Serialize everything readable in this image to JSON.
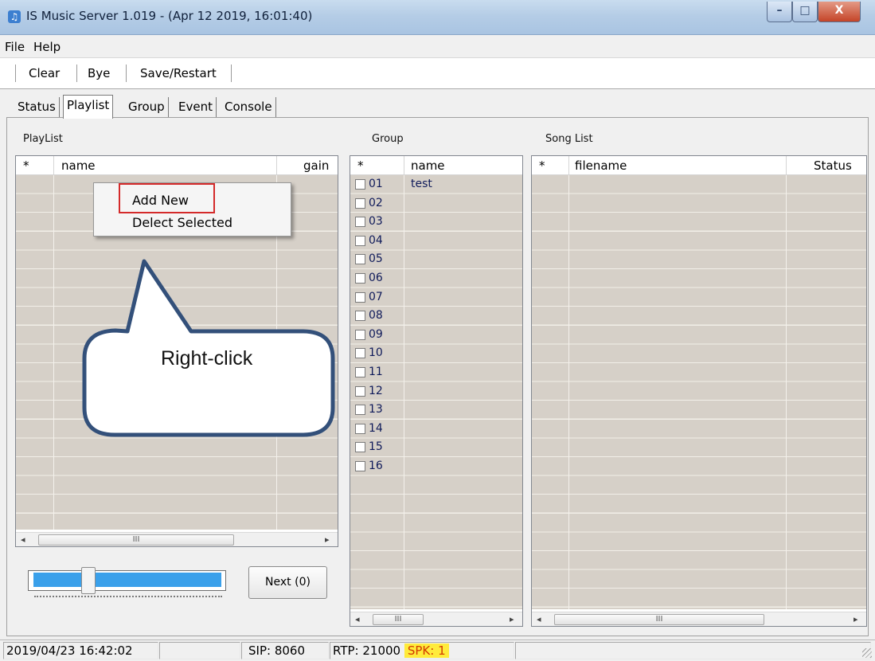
{
  "window": {
    "title": "IS Music Server 1.019 - (Apr 12 2019, 16:01:40)",
    "icon": "music-note-icon",
    "min_glyph": "–",
    "max_glyph": "□",
    "close_glyph": "X"
  },
  "menu": {
    "file": "File",
    "help": "Help"
  },
  "toolbar": {
    "clear": "Clear",
    "bye": "Bye",
    "save_restart": "Save/Restart"
  },
  "tabs": [
    "Status",
    "Playlist",
    "Group",
    "Event",
    "Console"
  ],
  "active_tab": "Playlist",
  "playlist": {
    "label": "PlayList",
    "columns": [
      "*",
      "name",
      "gain"
    ],
    "context_menu": [
      "Add New",
      "Delect Selected"
    ]
  },
  "group": {
    "label": "Group",
    "columns": [
      "*",
      "name"
    ],
    "rows": [
      {
        "num": "01",
        "name": "test"
      },
      {
        "num": "02",
        "name": ""
      },
      {
        "num": "03",
        "name": ""
      },
      {
        "num": "04",
        "name": ""
      },
      {
        "num": "05",
        "name": ""
      },
      {
        "num": "06",
        "name": ""
      },
      {
        "num": "07",
        "name": ""
      },
      {
        "num": "08",
        "name": ""
      },
      {
        "num": "09",
        "name": ""
      },
      {
        "num": "10",
        "name": ""
      },
      {
        "num": "11",
        "name": ""
      },
      {
        "num": "12",
        "name": ""
      },
      {
        "num": "13",
        "name": ""
      },
      {
        "num": "14",
        "name": ""
      },
      {
        "num": "15",
        "name": ""
      },
      {
        "num": "16",
        "name": ""
      }
    ]
  },
  "songlist": {
    "label": "Song List",
    "columns": [
      "*",
      "filename",
      "Status"
    ]
  },
  "scroll": {
    "left": "◂",
    "right": "▸",
    "thumb": "III"
  },
  "player": {
    "next": "Next (0)"
  },
  "callout": "Right-click",
  "status": {
    "datetime": "2019/04/23 16:42:02",
    "sip": "SIP: 8060",
    "rtp": "RTP: 21000",
    "spk": "SPK: 1"
  },
  "colors": {
    "grid_body": "#d6d0c8",
    "highlight": "#d42a2a",
    "slider": "#3aa0ea",
    "spk_bg": "#ffeb3b",
    "spk_fg": "#d23a00"
  }
}
